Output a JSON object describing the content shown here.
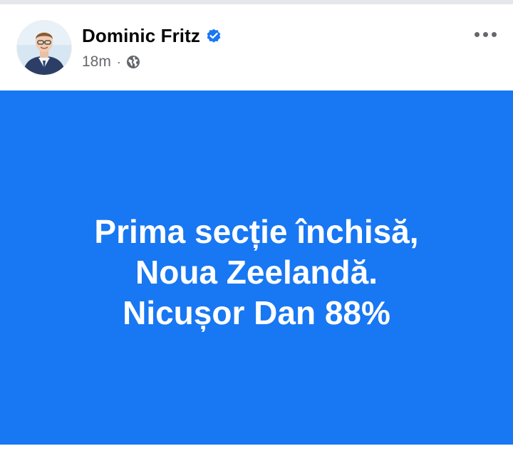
{
  "post": {
    "author": {
      "name": "Dominic Fritz",
      "verified": true,
      "avatar": "author-avatar"
    },
    "meta": {
      "time": "18m",
      "separator": "·",
      "audience_icon": "globe-icon"
    },
    "more_icon": "more-horizontal-icon",
    "card": {
      "background": "#1877F2",
      "text_color": "#FFFFFF",
      "lines": [
        "Prima secție închisă,",
        "Noua Zeelandă.",
        "Nicușor Dan 88%"
      ]
    }
  },
  "colors": {
    "verified_blue": "#1877F2",
    "secondary_text": "#65676B",
    "primary_text": "#050505"
  }
}
